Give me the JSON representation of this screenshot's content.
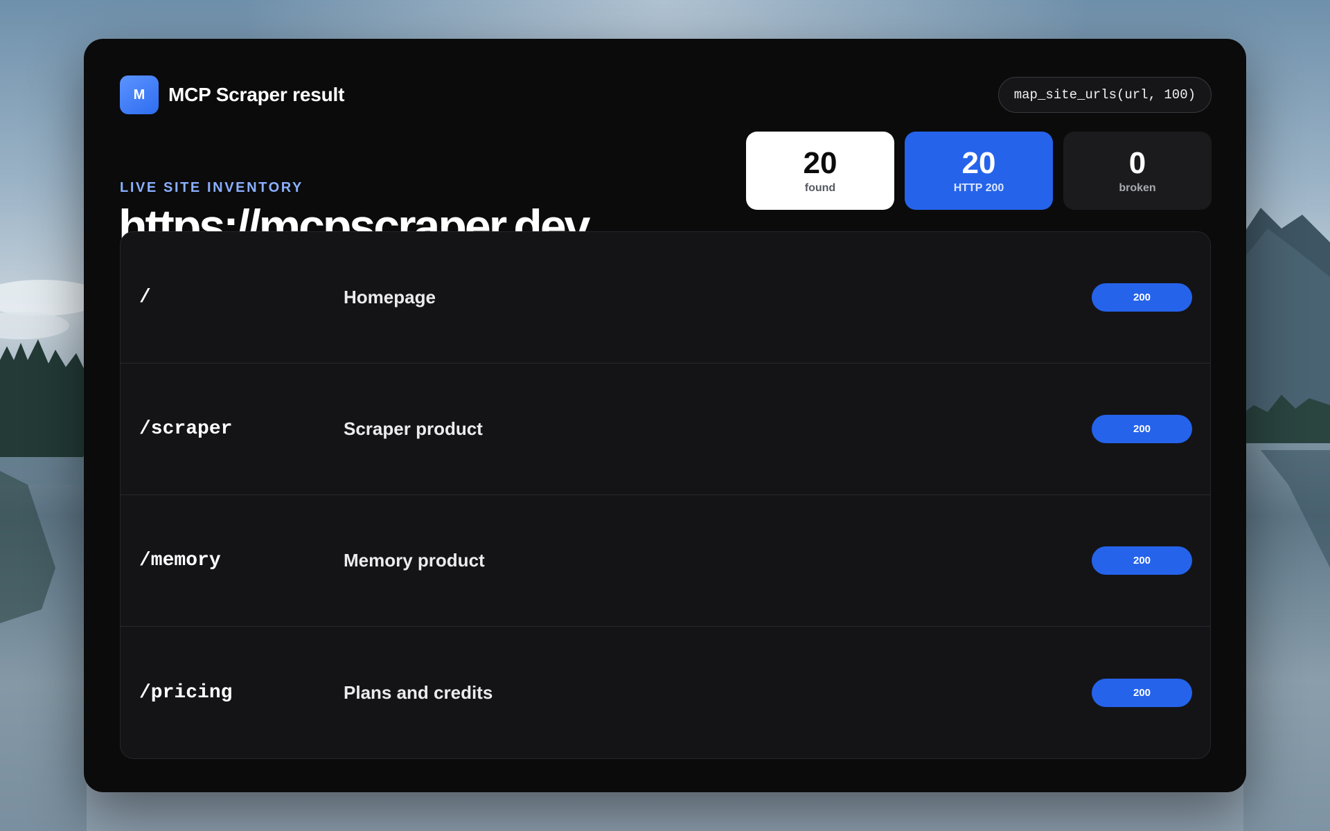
{
  "header": {
    "logo_letter": "M",
    "title": "MCP Scraper result",
    "call": "map_site_urls(url, 100)"
  },
  "site": {
    "eyebrow": "LIVE SITE INVENTORY",
    "url": "https://mcpscraper.dev"
  },
  "stats": [
    {
      "value": "20",
      "label": "found",
      "style": "light"
    },
    {
      "value": "20",
      "label": "HTTP 200",
      "style": "blue"
    },
    {
      "value": "0",
      "label": "broken",
      "style": "dark"
    }
  ],
  "rows": [
    {
      "path": "/",
      "description": "Homepage",
      "status": "200"
    },
    {
      "path": "/scraper",
      "description": "Scraper product",
      "status": "200"
    },
    {
      "path": "/memory",
      "description": "Memory product",
      "status": "200"
    },
    {
      "path": "/pricing",
      "description": "Plans and credits",
      "status": "200"
    }
  ],
  "colors": {
    "accent": "#2563eb",
    "card_bg": "#0b0b0c",
    "eyebrow": "#8ab0ff",
    "table_bg": "#141417"
  }
}
